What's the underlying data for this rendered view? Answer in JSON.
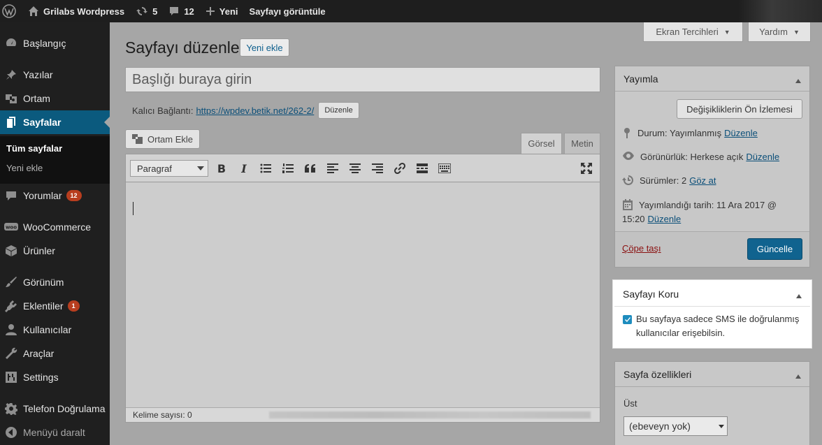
{
  "adminbar": {
    "site_name": "Grilabs Wordpress",
    "updates_count": "5",
    "comments_count": "12",
    "new_label": "Yeni",
    "view_page_label": "Sayfayı görüntüle"
  },
  "sidebar": {
    "items": [
      {
        "label": "Başlangıç",
        "icon": "dashboard-icon"
      },
      {
        "label": "Yazılar",
        "icon": "pin-icon"
      },
      {
        "label": "Ortam",
        "icon": "media-icon"
      },
      {
        "label": "Sayfalar",
        "icon": "pages-icon"
      },
      {
        "label": "Yorumlar",
        "icon": "comments-icon",
        "badge": "12"
      },
      {
        "label": "WooCommerce",
        "icon": "woo-icon"
      },
      {
        "label": "Ürünler",
        "icon": "box-icon"
      },
      {
        "label": "Görünüm",
        "icon": "brush-icon"
      },
      {
        "label": "Eklentiler",
        "icon": "plugin-icon",
        "badge": "1"
      },
      {
        "label": "Kullanıcılar",
        "icon": "user-icon"
      },
      {
        "label": "Araçlar",
        "icon": "wrench-icon"
      },
      {
        "label": "Settings",
        "icon": "settings-icon"
      },
      {
        "label": "Telefon Doğrulama",
        "icon": "gear-icon"
      }
    ],
    "submenu": [
      "Tüm sayfalar",
      "Yeni ekle"
    ],
    "collapse_label": "Menüyü daralt"
  },
  "header": {
    "title": "Sayfayı düzenle",
    "add_new_label": "Yeni ekle",
    "screen_options": "Ekran Tercihleri",
    "help": "Yardım"
  },
  "editor": {
    "title_placeholder": "Başlığı buraya girin",
    "permalink_label": "Kalıcı Bağlantı:",
    "permalink_url": "https://wpdev.betik.net/262-2/",
    "permalink_edit": "Düzenle",
    "add_media": "Ortam Ekle",
    "tab_visual": "Görsel",
    "tab_text": "Metin",
    "format": "Paragraf",
    "word_count": "Kelime sayısı: 0"
  },
  "publish": {
    "title": "Yayımla",
    "preview_changes": "Değişikliklerin Ön İzlemesi",
    "status_label": "Durum: Yayımlanmış",
    "status_edit": "Düzenle",
    "visibility_label": "Görünürlük: Herkese açık",
    "visibility_edit": "Düzenle",
    "revisions_label": "Sürümler: 2",
    "revisions_link": "Göz at",
    "published_label": "Yayımlandığı tarih: 11 Ara 2017 @",
    "published_time": "15:20",
    "published_edit": "Düzenle",
    "trash": "Çöpe taşı",
    "update": "Güncelle"
  },
  "protect": {
    "title": "Sayfayı Koru",
    "checkbox_text": "Bu sayfaya sadece SMS ile doğrulanmış kullanıcılar erişebilsin."
  },
  "attributes": {
    "title": "Sayfa özellikleri",
    "parent_label": "Üst",
    "parent_value": "(ebeveyn yok)"
  },
  "colors": {
    "accent": "#0073aa",
    "update_button": "#10638f",
    "badge": "#d54e21"
  }
}
